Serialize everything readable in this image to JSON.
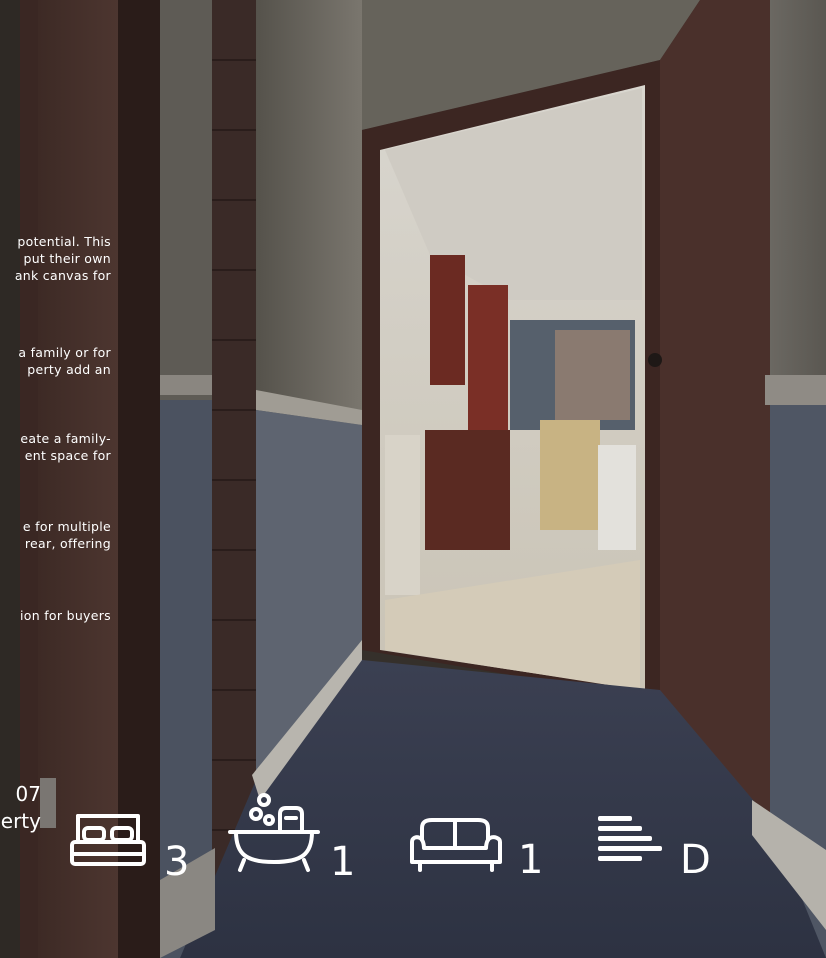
{
  "description_fragments": [
    [
      "potential. This",
      "put their own",
      "ank canvas for"
    ],
    [
      "a family or for",
      "perty add an"
    ],
    [
      "eate a family-",
      "ent space for"
    ],
    [
      "e for multiple",
      "rear, offering"
    ],
    [
      "ion for buyers"
    ]
  ],
  "corner_fragments": [
    "07",
    "erty"
  ],
  "features": {
    "bedrooms": {
      "icon": "bed-icon",
      "value": "3"
    },
    "bathrooms": {
      "icon": "bathtub-icon",
      "value": "1"
    },
    "receptions": {
      "icon": "sofa-icon",
      "value": "1"
    },
    "epc": {
      "icon": "epc-rating-icon",
      "value": "D"
    }
  }
}
